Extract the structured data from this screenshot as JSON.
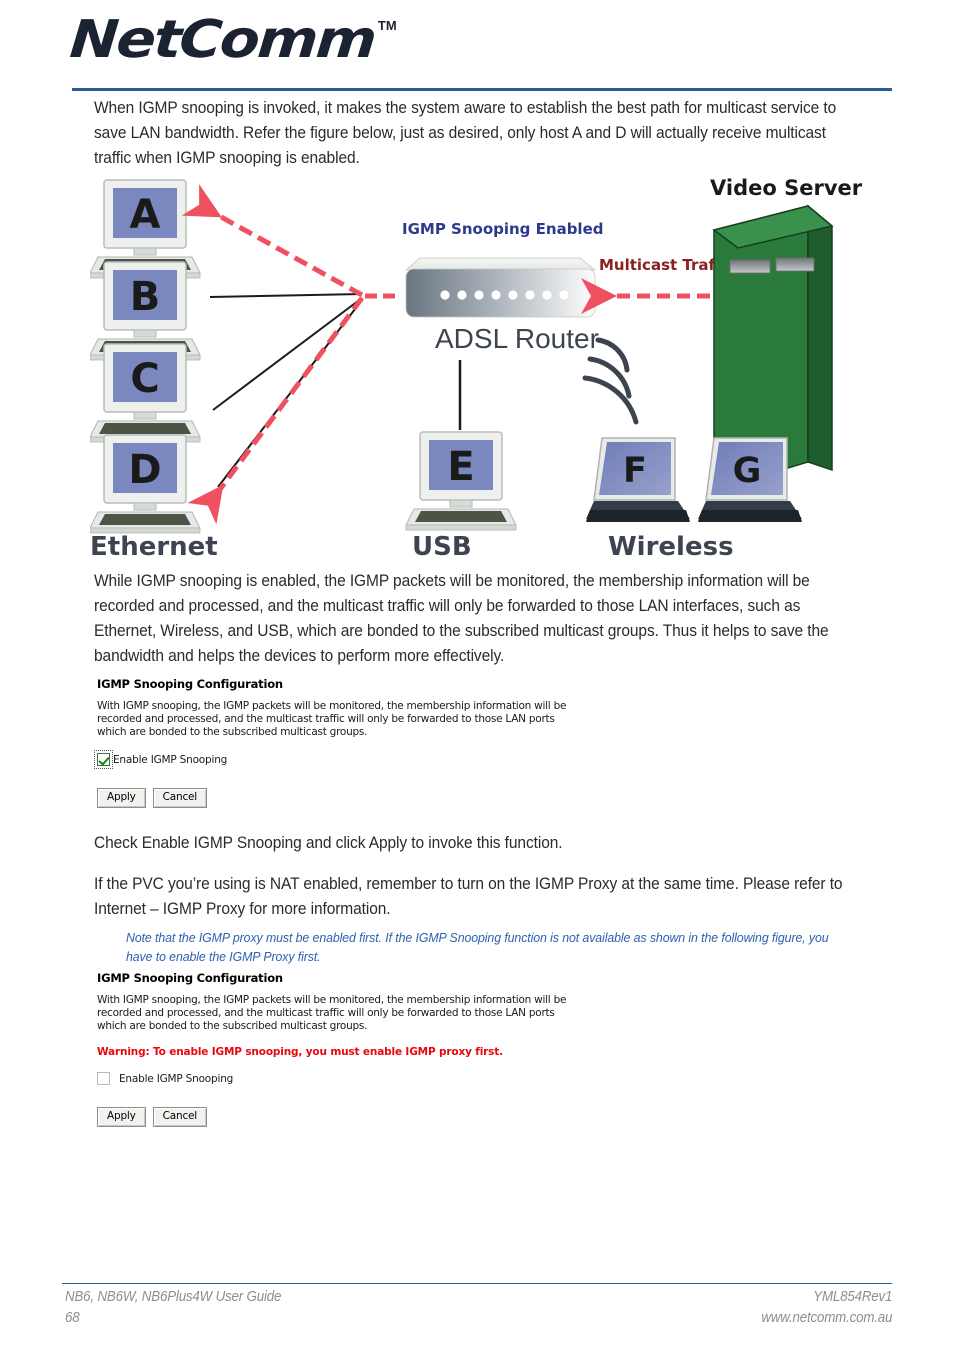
{
  "header": {
    "logo_text": "NetComm",
    "logo_trademark": "TM",
    "rule_color": "#2a5b94"
  },
  "paragraphs": {
    "intro": "When IGMP snooping is invoked, it makes the system aware to establish the best path for multicast service to save LAN bandwidth. Refer the figure below, just as desired, only host A and D will actually receive multicast traffic when IGMP snooping is enabled.",
    "after_diagram": "While IGMP snooping is enabled, the IGMP packets will be monitored, the membership information will be recorded and processed, and the multicast traffic will only be forwarded to those LAN interfaces, such as Ethernet, Wireless, and USB, which are bonded to the subscribed multicast groups. Thus it helps to save the bandwidth and helps the devices to perform more effectively.",
    "check_enable": "Check Enable IGMP Snooping and click Apply to invoke this function.",
    "pvc_nat": "If the PVC you’re using is NAT enabled, remember to turn on the IGMP Proxy at the same time. Please refer to Internet – IGMP Proxy for more information.",
    "note": "Note that the IGMP proxy must be enabled first. If the IGMP Snooping function is not available as shown in the following figure, you have to enable the IGMP Proxy first."
  },
  "diagram": {
    "hosts": {
      "a": "A",
      "b": "B",
      "c": "C",
      "d": "D",
      "e": "E",
      "f": "F",
      "g": "G"
    },
    "labels": {
      "ethernet": "Ethernet",
      "usb": "USB",
      "wireless": "Wireless",
      "router": "ADSL Router",
      "igmp_snooping_enabled": "IGMP Snooping Enabled",
      "multicast_traffic": "Multicast Traffic",
      "video_server": "Video Server"
    },
    "colors": {
      "multicast_arrow": "#ef5160",
      "snooping_label": "#2d3a8c",
      "multicast_label": "#8b2020",
      "server_front": "#2a7a3c",
      "server_side": "#1e5c2c",
      "screen": "#7b87bf",
      "keyboard": "#4c5445",
      "device_text": "#3d4450"
    },
    "led_count": 8
  },
  "ui_shot_enabled": {
    "heading": "IGMP Snooping Configuration",
    "description": "With IGMP snooping, the IGMP packets will be monitored, the membership information will be recorded and processed, and the multicast traffic will only be forwarded to those LAN ports which are bonded to the subscribed multicast groups.",
    "checkbox_label": "Enable IGMP Snooping",
    "checkbox_checked": "checked",
    "apply_label": "Apply",
    "cancel_label": "Cancel"
  },
  "ui_shot_warning": {
    "heading": "IGMP Snooping Configuration",
    "description": "With IGMP snooping, the IGMP packets will be monitored, the membership information will be recorded and processed, and the multicast traffic will only be forwarded to those LAN ports which are bonded to the subscribed multicast groups.",
    "warning": "Warning: To enable IGMP snooping, you must enable IGMP proxy first.",
    "warning_color": "#e8070c",
    "checkbox_label": "Enable IGMP Snooping",
    "checkbox_checked": "unchecked",
    "apply_label": "Apply",
    "cancel_label": "Cancel"
  },
  "footer": {
    "guide": "NB6, NB6W, NB6Plus4W User Guide",
    "page_number": "68",
    "doc_code": "YML854Rev1",
    "website": "www.netcomm.com.au"
  }
}
